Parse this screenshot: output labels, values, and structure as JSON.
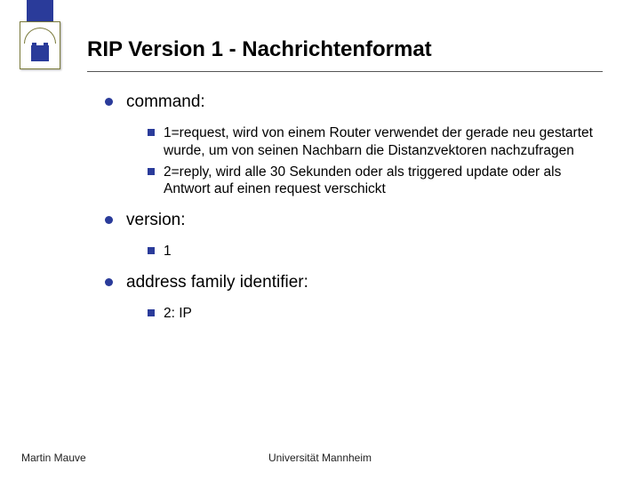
{
  "title": "RIP Version 1 - Nachrichtenformat",
  "bullets": {
    "b1": {
      "label": "command:",
      "sub": [
        "1=request, wird von einem Router verwendet der gerade neu gestartet wurde, um von seinen Nachbarn die Distanzvektoren nachzufragen",
        "2=reply, wird alle 30 Sekunden oder als triggered update oder als Antwort auf einen request verschickt"
      ]
    },
    "b2": {
      "label": "version:",
      "sub": [
        "1"
      ]
    },
    "b3": {
      "label": "address family identifier:",
      "sub": [
        "2: IP"
      ]
    }
  },
  "footer": {
    "left": "Martin Mauve",
    "center": "Universität Mannheim"
  }
}
